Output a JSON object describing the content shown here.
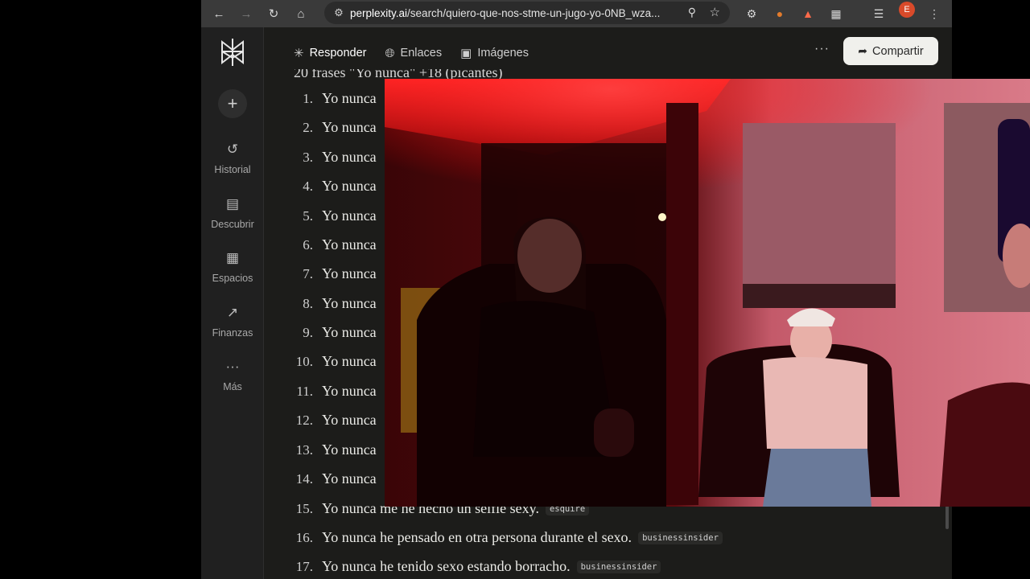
{
  "browser": {
    "url_host": "perplexity.ai",
    "url_path": "/search/quiero-que-nos-stme-un-jugo-yo-0NB_wza...",
    "avatar_letter": "E"
  },
  "rail": {
    "items": [
      {
        "label": "Historial",
        "icon": "history-icon"
      },
      {
        "label": "Descubrir",
        "icon": "discover-icon"
      },
      {
        "label": "Espacios",
        "icon": "spaces-icon"
      },
      {
        "label": "Finanzas",
        "icon": "finance-icon"
      },
      {
        "label": "Más",
        "icon": "more-icon"
      }
    ]
  },
  "header": {
    "tabs": [
      {
        "label": "Responder",
        "icon": "answer-icon"
      },
      {
        "label": "Enlaces",
        "icon": "globe-icon"
      },
      {
        "label": "Imágenes",
        "icon": "image-icon"
      }
    ],
    "more": "···",
    "share_label": "Compartir"
  },
  "content": {
    "cut_heading": "20 frases \"Yo nunca\" +18 (picantes)",
    "items": [
      {
        "num": "1.",
        "text": "Yo nunca",
        "source": ""
      },
      {
        "num": "2.",
        "text": "Yo nunca",
        "source": ""
      },
      {
        "num": "3.",
        "text": "Yo nunca",
        "source": ""
      },
      {
        "num": "4.",
        "text": "Yo nunca",
        "source": ""
      },
      {
        "num": "5.",
        "text": "Yo nunca",
        "source": ""
      },
      {
        "num": "6.",
        "text": "Yo nunca",
        "source": ""
      },
      {
        "num": "7.",
        "text": "Yo nunca",
        "source": ""
      },
      {
        "num": "8.",
        "text": "Yo nunca",
        "source": ""
      },
      {
        "num": "9.",
        "text": "Yo nunca",
        "source": ""
      },
      {
        "num": "10.",
        "text": "Yo nunca",
        "source": ""
      },
      {
        "num": "11.",
        "text": "Yo nunca",
        "source": ""
      },
      {
        "num": "12.",
        "text": "Yo nunca",
        "source": ""
      },
      {
        "num": "13.",
        "text": "Yo nunca",
        "source": ""
      },
      {
        "num": "14.",
        "text": "Yo nunca",
        "source": ""
      },
      {
        "num": "15.",
        "text": "Yo nunca me he hecho un selfie sexy.",
        "source": "esquire"
      },
      {
        "num": "16.",
        "text": "Yo nunca he pensado en otra persona durante el sexo.",
        "source": "businessinsider"
      },
      {
        "num": "17.",
        "text": "Yo nunca he tenido sexo estando borracho.",
        "source": "businessinsider"
      }
    ]
  }
}
